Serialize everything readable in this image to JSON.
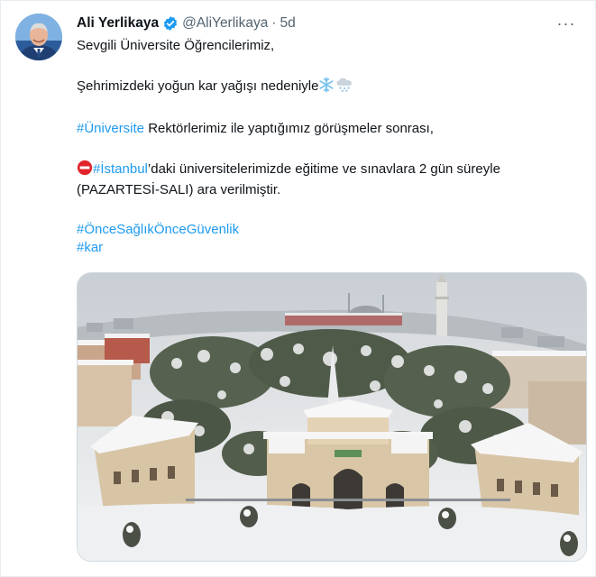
{
  "tweet": {
    "author_name": "Ali Yerlikaya",
    "handle": "@AliYerlikaya",
    "separator": "·",
    "time": "5d",
    "more_icon": "···",
    "lines": {
      "greeting": "Sevgili Üniversite Öğrencilerimiz,",
      "snow_text": "Şehrimizdeki yoğun kar yağışı nedeniyle",
      "uni_tag": "#Üniversite",
      "uni_text": " Rektörlerimiz ile yaptığımız görüşmeler sonrası,",
      "istanbul_tag": "#İstanbul",
      "istanbul_text": "’daki üniversitelerimizde eğitime ve sınavlara  2 gün süreyle",
      "days_text": "(PAZARTESİ-SALI) ara verilmiştir.",
      "tag1": "#ÖnceSağlıkÖnceGüvenlik",
      "tag2": "#kar"
    },
    "icons": {
      "verified": "verified-badge-icon",
      "snowflake": "snowflake-emoji",
      "cloud_snow": "cloud-with-snow-emoji",
      "no_entry": "no-entry-emoji"
    },
    "colors": {
      "link": "#1d9bf0",
      "text": "#0f1419",
      "muted": "#536471",
      "verified": "#1d9bf0",
      "no_entry": "#e0242a"
    },
    "media": {
      "subject": "aerial-snowy-university-gate-photo"
    }
  }
}
